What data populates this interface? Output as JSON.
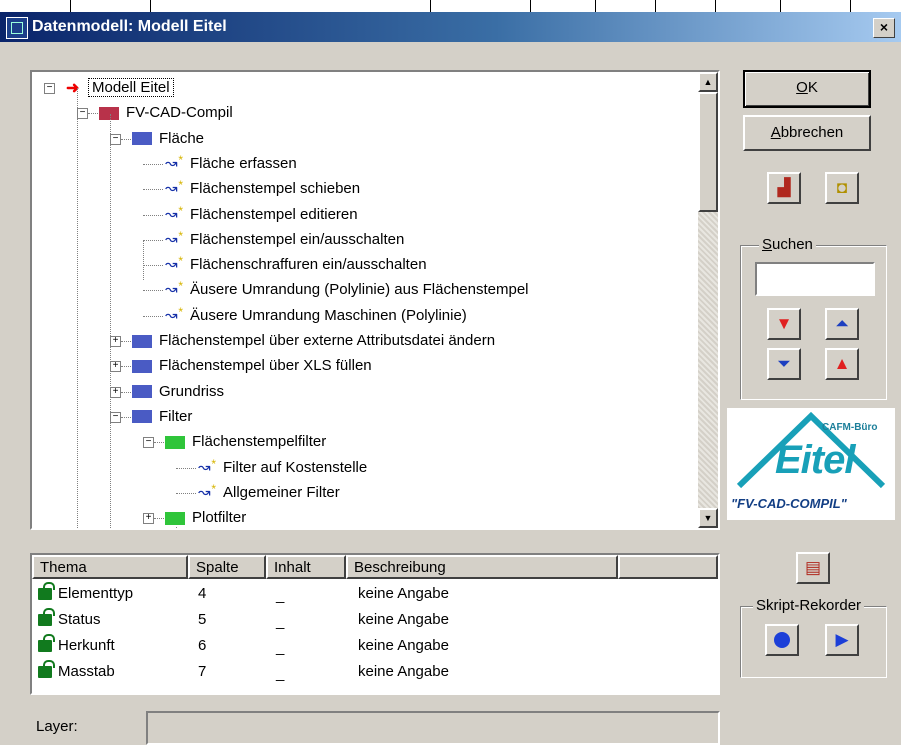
{
  "window": {
    "title": "Datenmodell: Modell Eitel",
    "close_label": "×"
  },
  "tree": {
    "rows": [
      {
        "label": "Modell Eitel",
        "level": 0,
        "icon": "red-arrow-icon",
        "expander": "−",
        "selected": true
      },
      {
        "label": "FV-CAD-Compil",
        "level": 1,
        "icon": "folder-red-icon",
        "expander": "−"
      },
      {
        "label": "Fläche",
        "level": 2,
        "icon": "folder-open-blue-icon",
        "expander": "−"
      },
      {
        "label": "Fläche erfassen",
        "level": 3,
        "icon": "command-icon",
        "expander": ""
      },
      {
        "label": "Flächenstempel schieben",
        "level": 3,
        "icon": "command-icon",
        "expander": ""
      },
      {
        "label": "Flächenstempel editieren",
        "level": 3,
        "icon": "command-icon",
        "expander": ""
      },
      {
        "label": "Flächenstempel ein/ausschalten",
        "level": 3,
        "icon": "command-icon",
        "expander": ""
      },
      {
        "label": "Flächenschraffuren ein/ausschalten",
        "level": 3,
        "icon": "command-icon",
        "expander": ""
      },
      {
        "label": "Äusere Umrandung (Polylinie) aus Flächenstempel",
        "level": 3,
        "icon": "command-icon",
        "expander": ""
      },
      {
        "label": "Äusere Umrandung Maschinen (Polylinie)",
        "level": 3,
        "icon": "command-icon",
        "expander": ""
      },
      {
        "label": "Flächenstempel über externe Attributsdatei ändern",
        "level": 2,
        "icon": "folder-blue-icon",
        "expander": "+"
      },
      {
        "label": "Flächenstempel über XLS füllen",
        "level": 2,
        "icon": "folder-blue-icon",
        "expander": "+"
      },
      {
        "label": "Grundriss",
        "level": 2,
        "icon": "folder-blue-icon",
        "expander": "+"
      },
      {
        "label": "Filter",
        "level": 2,
        "icon": "folder-open-blue-icon",
        "expander": "−"
      },
      {
        "label": "Flächenstempelfilter",
        "level": 3,
        "icon": "folder-open-green-icon",
        "expander": "−"
      },
      {
        "label": "Filter auf Kostenstelle",
        "level": 4,
        "icon": "command-icon",
        "expander": ""
      },
      {
        "label": "Allgemeiner Filter",
        "level": 4,
        "icon": "command-icon",
        "expander": ""
      },
      {
        "label": "Plotfilter",
        "level": 3,
        "icon": "folder-green-icon",
        "expander": "+"
      }
    ]
  },
  "table": {
    "headers": [
      "Thema",
      "Spalte",
      "Inhalt",
      "Beschreibung"
    ],
    "rows": [
      {
        "thema": "Elementtyp",
        "spalte": "4",
        "inhalt": "_",
        "beschreibung": "keine Angabe"
      },
      {
        "thema": "Status",
        "spalte": "5",
        "inhalt": "_",
        "beschreibung": "keine Angabe"
      },
      {
        "thema": "Herkunft",
        "spalte": "6",
        "inhalt": "_",
        "beschreibung": "keine Angabe"
      },
      {
        "thema": "Masstab",
        "spalte": "7",
        "inhalt": "_",
        "beschreibung": "keine Angabe"
      }
    ]
  },
  "buttons": {
    "ok_label": "OK",
    "cancel_label": "Abbrechen"
  },
  "search": {
    "label": "Suchen",
    "value": ""
  },
  "recorder": {
    "label": "Skript-Rekorder"
  },
  "layer": {
    "label": "Layer:",
    "value": ""
  },
  "logo": {
    "top": "CAFM-Büro",
    "main": "Eitel",
    "bottom": "\"FV-CAD-COMPIL\""
  },
  "colors": {
    "title_start": "#0a246a",
    "title_end": "#a6caf0",
    "dialog_bg": "#d4d0c8"
  }
}
